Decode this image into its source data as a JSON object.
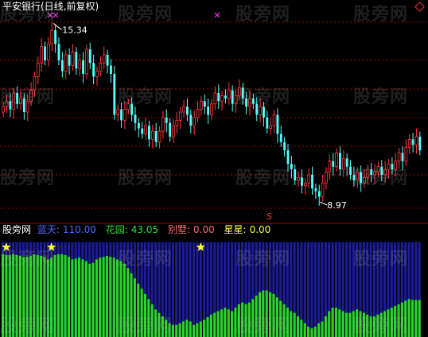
{
  "title": "平安银行(日线,前复权)",
  "watermark": "股旁网",
  "price_panel": {
    "high_label": "15.34",
    "low_label": "8.97",
    "s_marker": "S",
    "colors": {
      "up": "#ff3b3b",
      "down": "#54ffff",
      "grid": "#a30000",
      "marker": "#e040e0"
    }
  },
  "indicator_panel": {
    "name": "股旁网",
    "legend": [
      {
        "label": "蓝天:",
        "value": "110.00",
        "color": "#4d6bff"
      },
      {
        "label": "花园:",
        "value": "43.05",
        "color": "#32dc32"
      },
      {
        "label": "别墅:",
        "value": "0.00",
        "color": "#ff6a6a"
      },
      {
        "label": "星星:",
        "value": "0.00",
        "color": "#ffff40"
      }
    ],
    "colors": {
      "sky": "#1c1c99",
      "garden": "#2bd42b",
      "star": "#ffff33"
    }
  },
  "chart_data": [
    {
      "type": "candlestick",
      "title": "平安银行(日线,前复权)",
      "annotations": [
        {
          "text": "15.34",
          "kind": "high"
        },
        {
          "text": "8.97",
          "kind": "low"
        }
      ],
      "close_series": [
        12.3,
        12.5,
        12.2,
        12.8,
        12.4,
        12.6,
        12.1,
        12.5,
        12.9,
        13.4,
        13.9,
        14.5,
        14.0,
        14.6,
        15.1,
        14.6,
        14.0,
        13.6,
        14.2,
        13.8,
        14.3,
        13.7,
        14.0,
        13.5,
        14.4,
        13.9,
        13.4,
        13.6,
        13.9,
        14.2,
        13.8,
        13.5,
        12.0,
        12.2,
        11.8,
        12.2,
        12.4,
        12.0,
        11.7,
        11.5,
        11.3,
        11.6,
        11.1,
        11.4,
        11.0,
        11.4,
        11.9,
        11.7,
        11.2,
        11.6,
        11.8,
        12.1,
        12.3,
        12.0,
        11.6,
        11.9,
        12.2,
        12.5,
        12.3,
        12.0,
        12.4,
        12.8,
        12.5,
        12.7,
        12.6,
        12.9,
        12.4,
        12.7,
        13.0,
        12.6,
        12.3,
        12.6,
        12.4,
        12.0,
        12.3,
        11.9,
        11.5,
        11.6,
        12.0,
        11.3,
        11.0,
        10.7,
        10.2,
        10.0,
        9.6,
        9.7,
        9.4,
        9.5,
        9.8,
        9.3,
        9.2,
        9.0,
        9.5,
        9.9,
        10.3,
        10.1,
        10.6,
        10.0,
        10.4,
        10.1,
        9.8,
        9.6,
        9.9,
        9.5,
        9.7,
        10.0,
        9.8,
        9.9,
        10.1,
        9.8,
        10.0,
        10.2,
        10.0,
        10.3,
        10.6,
        10.3,
        10.8,
        11.1,
        10.9,
        11.2,
        10.7
      ]
    },
    {
      "type": "bar",
      "title": "股旁网",
      "series": [
        {
          "name": "蓝天",
          "constant": 110.0
        },
        {
          "name": "花园",
          "values": [
            96,
            95,
            95,
            96,
            95,
            94,
            93,
            93,
            94,
            96,
            95,
            94,
            93,
            90,
            92,
            95,
            96,
            96,
            95,
            93,
            90,
            91,
            92,
            90,
            88,
            85,
            86,
            90,
            92,
            93,
            94,
            93,
            92,
            90,
            88,
            85,
            80,
            74,
            68,
            62,
            56,
            50,
            44,
            38,
            32,
            28,
            24,
            20,
            16,
            14,
            14,
            16,
            18,
            20,
            18,
            14,
            16,
            18,
            20,
            23,
            26,
            28,
            30,
            32,
            34,
            32,
            30,
            34,
            38,
            40,
            38,
            40,
            44,
            48,
            52,
            54,
            54,
            52,
            50,
            46,
            42,
            38,
            34,
            30,
            28,
            24,
            20,
            16,
            12,
            10,
            12,
            16,
            18,
            24,
            30,
            34,
            34,
            32,
            30,
            28,
            28,
            30,
            32,
            30,
            28,
            26,
            24,
            24,
            26,
            28,
            30,
            32,
            34,
            36,
            38,
            40,
            42,
            44,
            43,
            43,
            43
          ]
        },
        {
          "name": "星星",
          "marks": [
            1,
            14,
            57
          ]
        }
      ],
      "legend": [
        "蓝天: 110.00",
        "花园: 43.05",
        "别墅: 0.00",
        "星星: 0.00"
      ]
    }
  ]
}
